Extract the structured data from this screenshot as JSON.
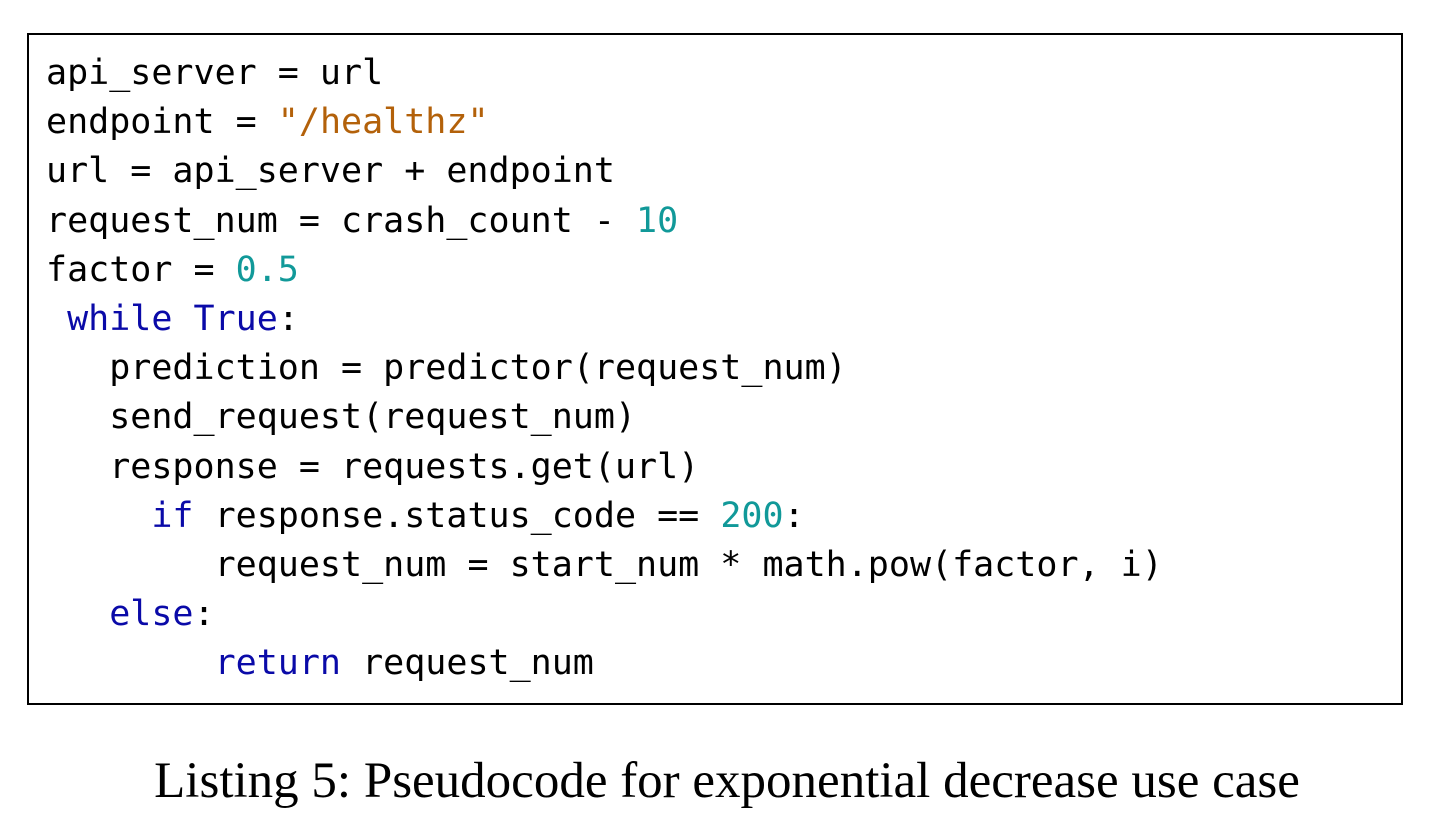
{
  "listing": {
    "caption": "Listing 5: Pseudocode for exponential decrease use case",
    "lines": [
      {
        "indent": "",
        "parts": [
          {
            "t": "text",
            "v": "api_server = url"
          }
        ]
      },
      {
        "indent": "",
        "parts": [
          {
            "t": "text",
            "v": "endpoint = "
          },
          {
            "t": "str",
            "v": "\"/healthz\""
          }
        ]
      },
      {
        "indent": "",
        "parts": [
          {
            "t": "text",
            "v": "url = api_server + endpoint"
          }
        ]
      },
      {
        "indent": "",
        "parts": [
          {
            "t": "text",
            "v": "request_num = crash_count - "
          },
          {
            "t": "num",
            "v": "10"
          }
        ]
      },
      {
        "indent": "",
        "parts": [
          {
            "t": "text",
            "v": "factor = "
          },
          {
            "t": "num",
            "v": "0.5"
          }
        ]
      },
      {
        "indent": " ",
        "parts": [
          {
            "t": "kw",
            "v": "while"
          },
          {
            "t": "text",
            "v": " "
          },
          {
            "t": "kw",
            "v": "True"
          },
          {
            "t": "text",
            "v": ":"
          }
        ]
      },
      {
        "indent": "   ",
        "parts": [
          {
            "t": "text",
            "v": "prediction = predictor(request_num)"
          }
        ]
      },
      {
        "indent": "   ",
        "parts": [
          {
            "t": "text",
            "v": "send_request(request_num)"
          }
        ]
      },
      {
        "indent": "   ",
        "parts": [
          {
            "t": "text",
            "v": "response = requests.get(url)"
          }
        ]
      },
      {
        "indent": "     ",
        "parts": [
          {
            "t": "kw",
            "v": "if"
          },
          {
            "t": "text",
            "v": " response.status_code == "
          },
          {
            "t": "num",
            "v": "200"
          },
          {
            "t": "text",
            "v": ":"
          }
        ]
      },
      {
        "indent": "        ",
        "parts": [
          {
            "t": "text",
            "v": "request_num = start_num * math.pow(factor, i)"
          }
        ]
      },
      {
        "indent": "   ",
        "parts": [
          {
            "t": "kw",
            "v": "else"
          },
          {
            "t": "text",
            "v": ":"
          }
        ]
      },
      {
        "indent": "        ",
        "parts": [
          {
            "t": "kw",
            "v": "return"
          },
          {
            "t": "text",
            "v": " request_num"
          }
        ]
      }
    ]
  },
  "colors": {
    "keyword": "#0a0aa8",
    "string": "#b3610a",
    "number": "#119999",
    "text": "#000000",
    "border": "#000000"
  }
}
